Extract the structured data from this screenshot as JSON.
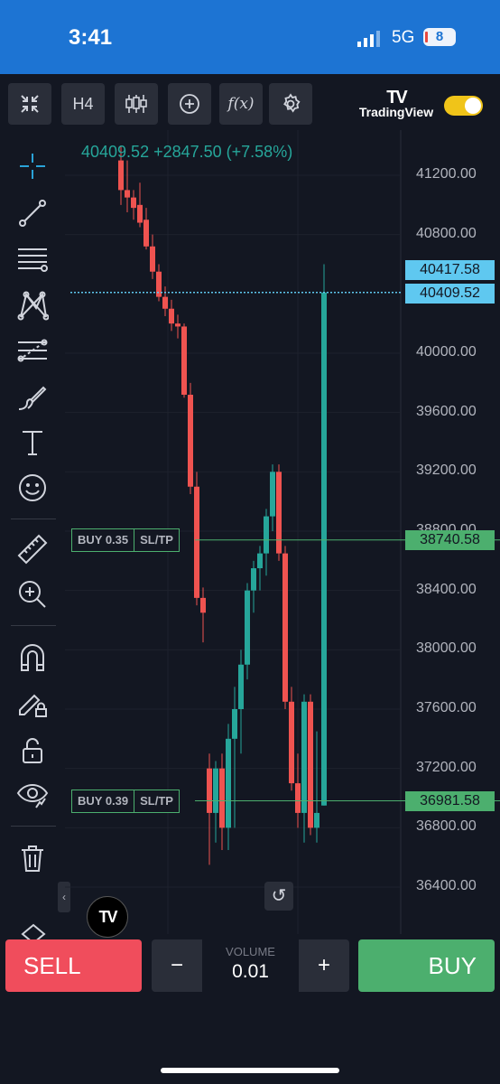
{
  "status_bar": {
    "time": "3:41",
    "network": "5G",
    "battery": "8"
  },
  "toolbar": {
    "fullscreen_icon": "fullscreen-collapse-icon",
    "timeframe": "H4",
    "chart_type_icon": "candlestick-icon",
    "add_icon": "plus-circle-icon",
    "indicators_label": "f(x)",
    "settings_icon": "gear-icon",
    "brand_logo": "TV",
    "brand_name": "TradingView",
    "theme_toggle_on": true
  },
  "left_tools": [
    "crosshair-icon",
    "trend-line-icon",
    "fib-retracement-icon",
    "pattern-icon",
    "prediction-icon",
    "brush-icon",
    "text-icon",
    "emoji-icon",
    "ruler-icon",
    "zoom-in-icon",
    "magnet-icon",
    "lock-drawing-icon",
    "unlock-icon",
    "eye-icon",
    "trash-icon"
  ],
  "chart": {
    "ohlc_text": "40409.52 +2847.50 (+7.58%)",
    "price_axis": [
      "41200.00",
      "40800.00",
      "40000.00",
      "39600.00",
      "39200.00",
      "38800.00",
      "38400.00",
      "38000.00",
      "37600.00",
      "37200.00",
      "36800.00",
      "36400.00"
    ],
    "price_tags": [
      {
        "text": "40417.58",
        "color": "#5fc8f0"
      },
      {
        "text": "40409.52",
        "color": "#5fc8f0"
      },
      {
        "text": "38740.58",
        "color": "#4caf6e"
      },
      {
        "text": "36981.58",
        "color": "#4caf6e"
      }
    ],
    "positions": [
      {
        "side": "BUY 0.35",
        "action": "SL/TP",
        "price": "38740.58"
      },
      {
        "side": "BUY 0.39",
        "action": "SL/TP",
        "price": "36981.58"
      }
    ],
    "colors": {
      "up": "#26a69a",
      "down": "#ef5350",
      "last_price": "#5fc8f0",
      "position_line": "#4caf6e"
    },
    "reset_icon": "reset-icon",
    "badge_logo": "TV"
  },
  "trade_panel": {
    "sell_label": "SELL",
    "volume_label": "VOLUME",
    "volume_value": "0.01",
    "minus_label": "−",
    "plus_label": "+",
    "buy_label": "BUY"
  }
}
